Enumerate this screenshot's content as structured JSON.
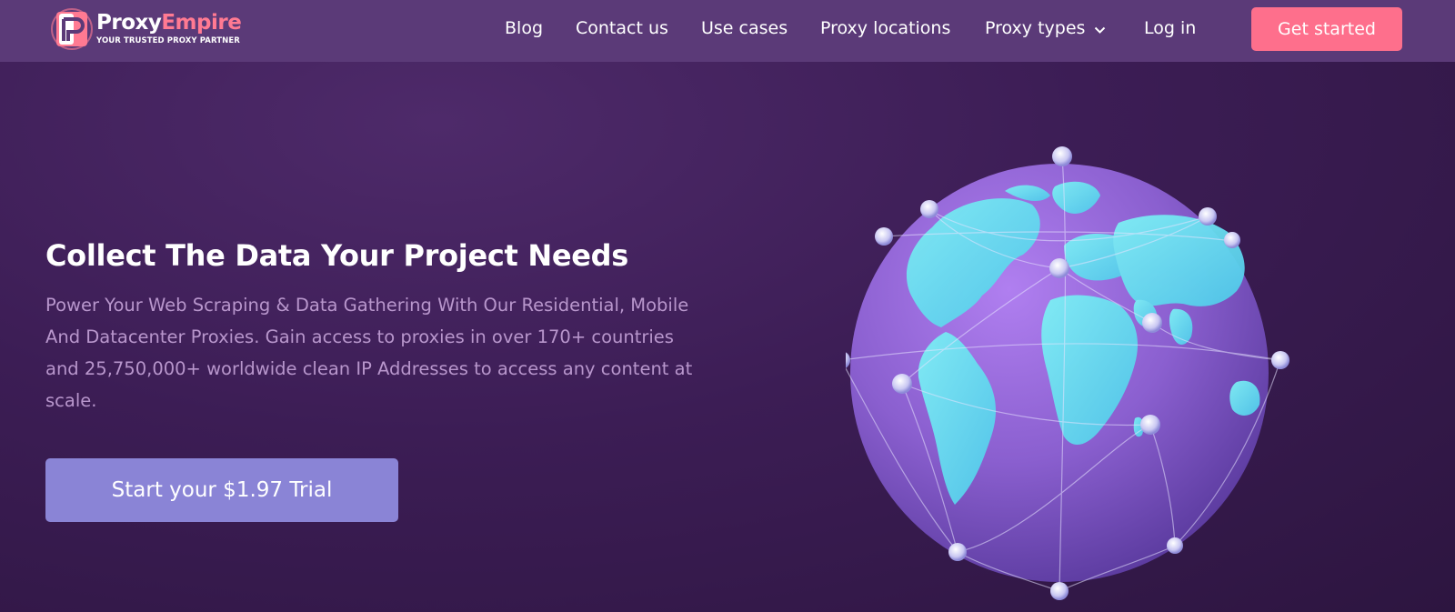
{
  "brand": {
    "name_part1": "Proxy",
    "name_part2": "Empire",
    "tagline": "YOUR TRUSTED PROXY PARTNER",
    "accent_color": "#fe6f8c"
  },
  "nav": {
    "links": [
      {
        "label": "Blog"
      },
      {
        "label": "Contact us"
      },
      {
        "label": "Use cases"
      },
      {
        "label": "Proxy locations"
      },
      {
        "label": "Proxy types",
        "icon": "chevron-down-icon"
      },
      {
        "label": "Log in"
      }
    ],
    "cta_label": "Get started"
  },
  "hero": {
    "title": "Collect The Data Your Project Needs",
    "description": "Power Your Web Scraping & Data Gathering With Our Residential, Mobile And Datacenter Proxies. Gain access to proxies in over 170+ countries and 25,750,000+ worldwide clean IP Addresses to access any content at scale.",
    "trial_button_label": "Start your $1.97 Trial",
    "illustration": "globe-network-illustration"
  }
}
